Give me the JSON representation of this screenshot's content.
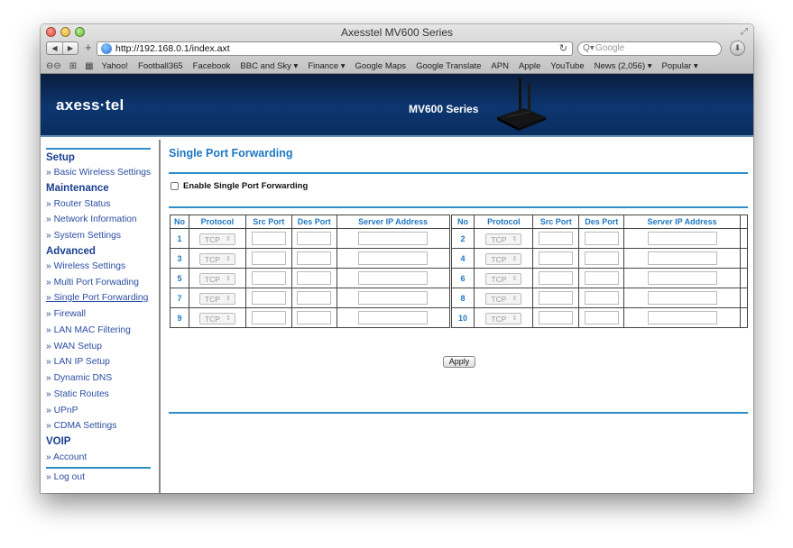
{
  "window": {
    "title": "Axesstel MV600 Series"
  },
  "browser": {
    "url": "http://192.168.0.1/index.axt",
    "search_placeholder": "Google",
    "bookmarks": [
      "Yahoo!",
      "Football365",
      "Facebook",
      "BBC and Sky ▾",
      "Finance ▾",
      "Google Maps",
      "Google Translate",
      "APN",
      "Apple",
      "YouTube",
      "News (2,056) ▾",
      "Popular ▾"
    ]
  },
  "banner": {
    "logo": "axess·tel",
    "product": "MV600 Series"
  },
  "sidebar": {
    "setup": "Setup",
    "basic_wireless": "» Basic Wireless Settings",
    "maintenance": "Maintenance",
    "router_status": "» Router Status",
    "network_info": "» Network Information",
    "system_settings": "» System Settings",
    "advanced": "Advanced",
    "wireless_settings": "» Wireless Settings",
    "multi_port": "» Multi Port Forwading",
    "single_port": "» Single Port Forwarding",
    "firewall": "» Firewall",
    "lan_mac": "» LAN MAC Filtering",
    "wan_setup": "» WAN Setup",
    "lan_ip": "» LAN IP Setup",
    "dynamic_dns": "» Dynamic DNS",
    "static_routes": "» Static Routes",
    "upnp": "» UPnP",
    "cdma": "» CDMA Settings",
    "voip": "VOIP",
    "account": "» Account",
    "logout": "» Log out"
  },
  "main": {
    "title": "Single Port Forwarding",
    "enable_label": "Enable Single Port Forwarding",
    "headers": {
      "no": "No",
      "protocol": "Protocol",
      "src": "Src Port",
      "des": "Des Port",
      "ip": "Server IP Address"
    },
    "rows": [
      {
        "a": "1",
        "b": "2"
      },
      {
        "a": "3",
        "b": "4"
      },
      {
        "a": "5",
        "b": "6"
      },
      {
        "a": "7",
        "b": "8"
      },
      {
        "a": "9",
        "b": "10"
      }
    ],
    "protocol_value": "TCP",
    "apply_label": "Apply"
  }
}
